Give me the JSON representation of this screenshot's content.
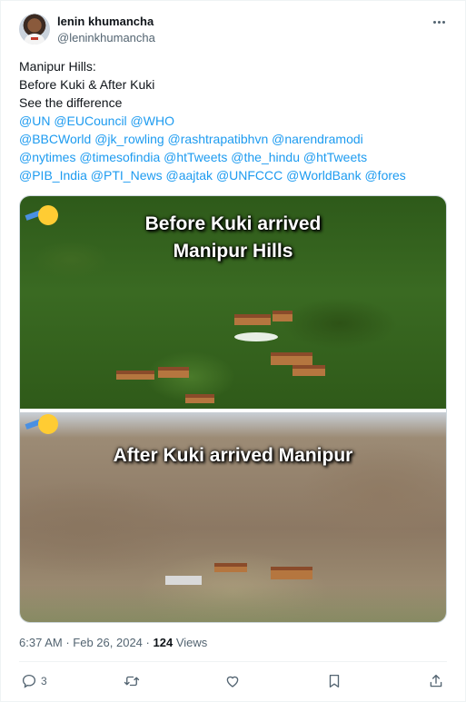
{
  "author": {
    "name": "lenin khumancha",
    "handle": "@leninkhumancha"
  },
  "tweet": {
    "lines": [
      "Manipur Hills:",
      "Before Kuki & After Kuki",
      "See the difference"
    ],
    "mentions": [
      "@UN @EUCouncil @WHO",
      "@BBCWorld @jk_rowling @rashtrapatibhvn @narendramodi",
      "@nytimes  @timesofindia @htTweets @the_hindu @htTweets",
      "@PIB_India @PTI_News @aajtak @UNFCCC @WorldBank @fores"
    ]
  },
  "media": {
    "top_caption_line1": "Before Kuki arrived",
    "top_caption_line2": "Manipur Hills",
    "bottom_caption": "After Kuki arrived Manipur"
  },
  "meta": {
    "time": "6:37 AM",
    "dot": "·",
    "date": "Feb 26, 2024",
    "views_count": "124",
    "views_label": "Views"
  },
  "actions": {
    "reply_count": "3",
    "icons": [
      "reply-icon",
      "retweet-icon",
      "like-icon",
      "bookmark-icon",
      "share-icon"
    ]
  },
  "colors": {
    "link": "#1d9bf0",
    "muted": "#536471",
    "text": "#0f1419"
  }
}
